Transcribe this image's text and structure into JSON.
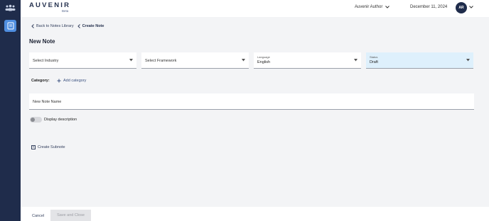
{
  "app": {
    "logo": "AUVENIR",
    "logo_badge": "Beta"
  },
  "header": {
    "role": "Auvenir Author",
    "date": "December 11, 2024",
    "avatar_initials": "AR"
  },
  "breadcrumb": {
    "back": "Back to Notes Library",
    "current": "Create Note"
  },
  "page": {
    "title": "New Note"
  },
  "fields": {
    "industry": {
      "placeholder": "Select Industry"
    },
    "framework": {
      "placeholder": "Select Framework"
    },
    "language": {
      "label": "Language",
      "value": "English"
    },
    "status": {
      "label": "Status",
      "value": "Draft"
    }
  },
  "category": {
    "label": "Category:",
    "add": "Add category"
  },
  "note_name": {
    "placeholder": "New Note Name"
  },
  "description_toggle": {
    "label": "Display description",
    "on": false
  },
  "subnote": {
    "label": "Create Subnote"
  },
  "footer": {
    "cancel": "Cancel",
    "save": "Save and Close"
  },
  "colors": {
    "rail": "#1f2c4b",
    "accent": "#4f8ee0",
    "status_bg": "#def0fc"
  }
}
